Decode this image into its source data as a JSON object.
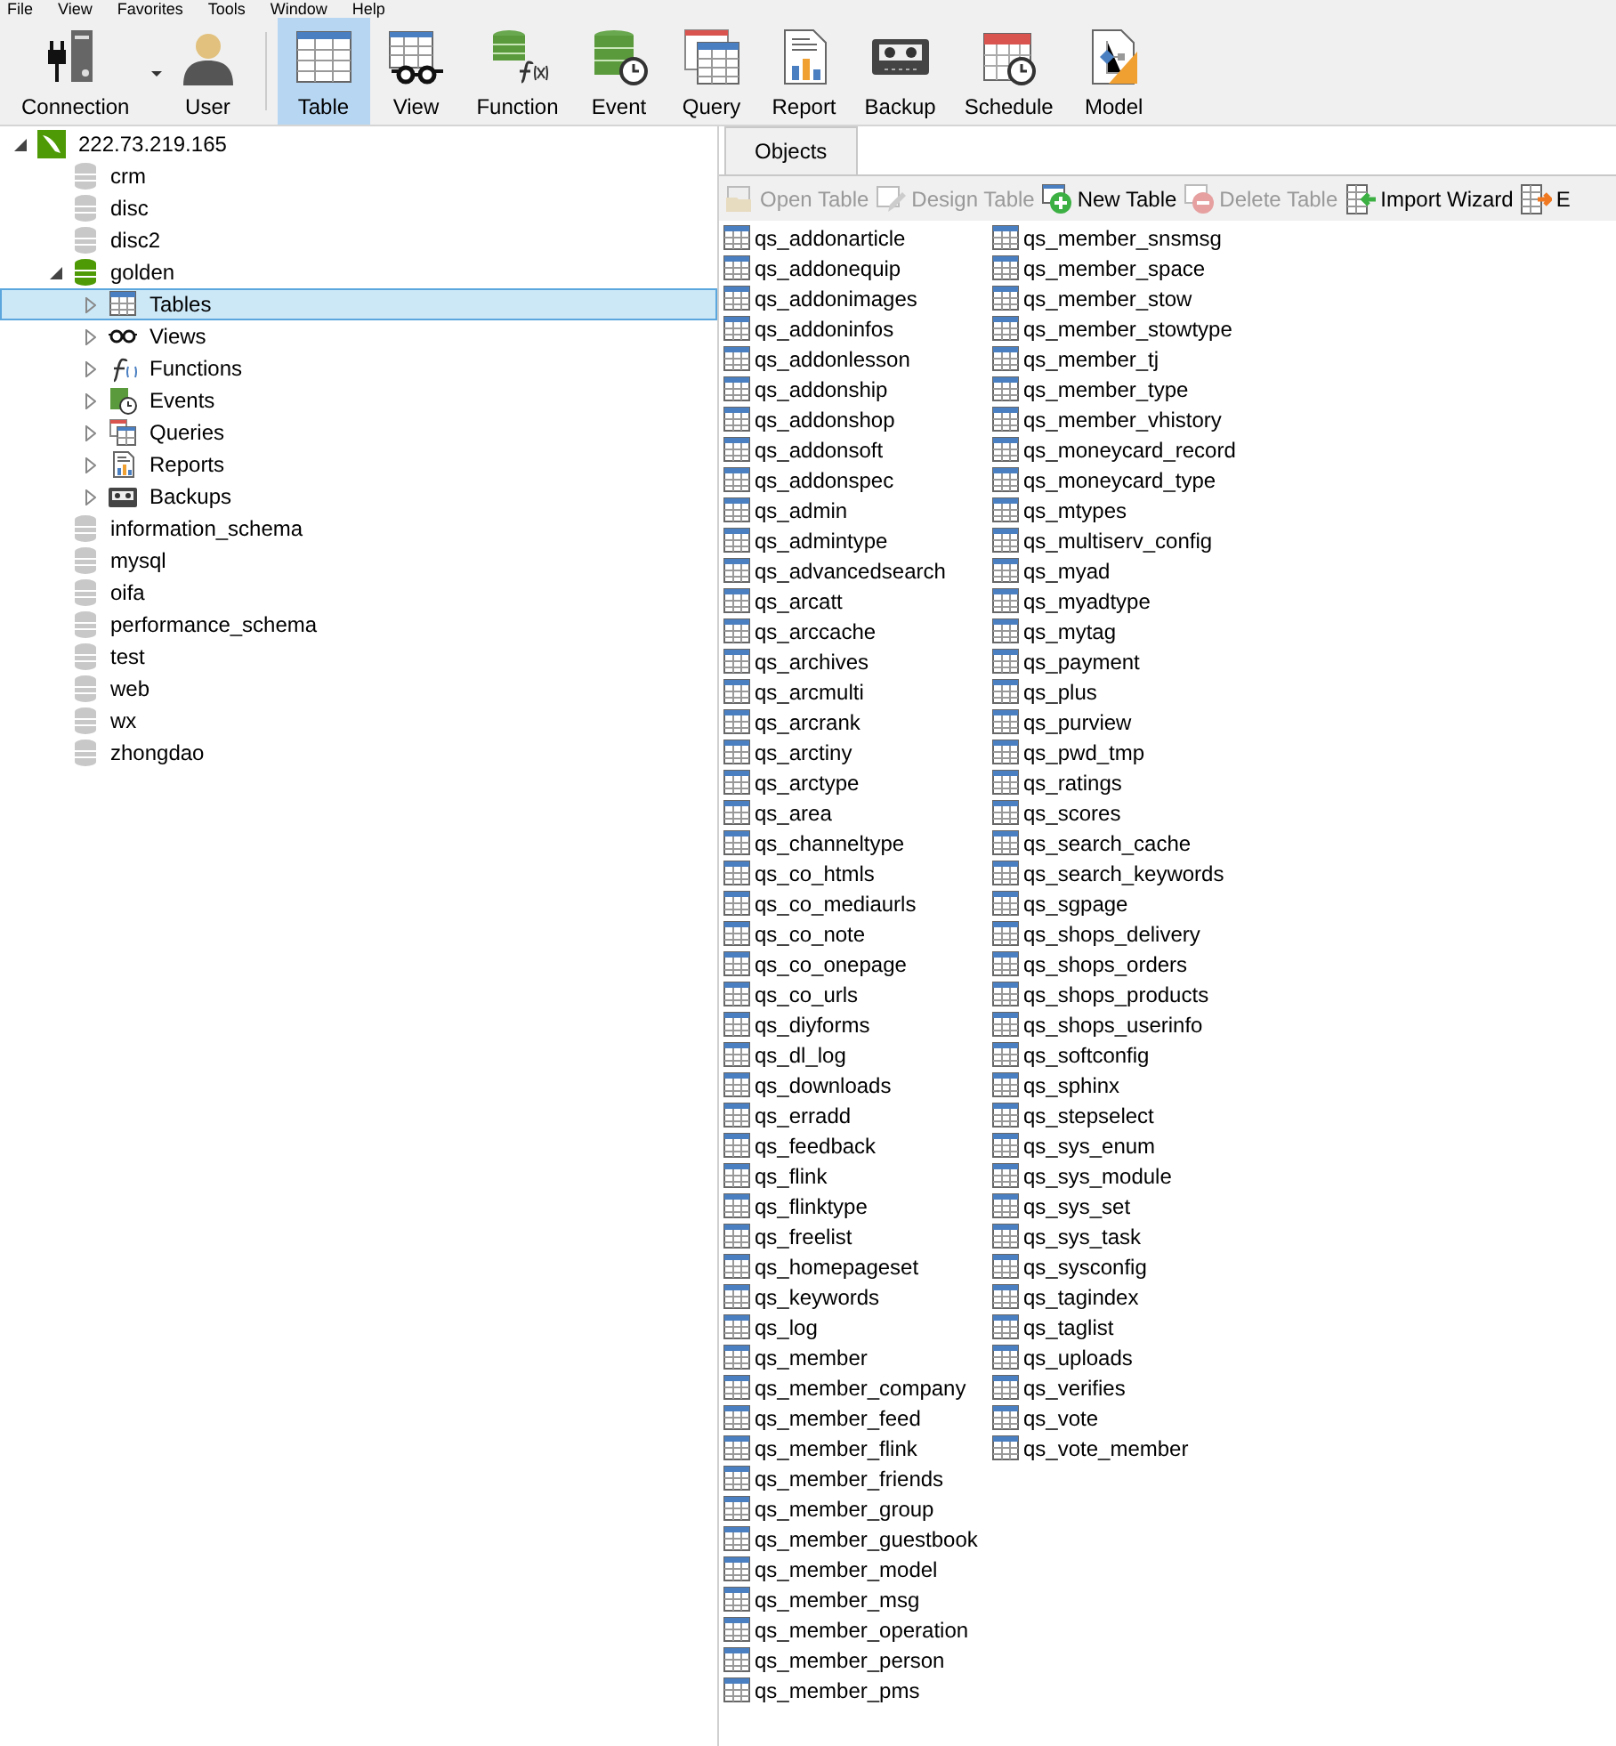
{
  "menu": [
    "File",
    "View",
    "Favorites",
    "Tools",
    "Window",
    "Help"
  ],
  "toolbar": [
    {
      "kind": "connection",
      "label": "Connection",
      "selected": false,
      "dropdown": true
    },
    {
      "kind": "user",
      "label": "User",
      "selected": false
    },
    {
      "kind": "table",
      "label": "Table",
      "selected": true
    },
    {
      "kind": "view",
      "label": "View",
      "selected": false
    },
    {
      "kind": "function",
      "label": "Function",
      "selected": false
    },
    {
      "kind": "event",
      "label": "Event",
      "selected": false
    },
    {
      "kind": "query",
      "label": "Query",
      "selected": false
    },
    {
      "kind": "report",
      "label": "Report",
      "selected": false
    },
    {
      "kind": "backup",
      "label": "Backup",
      "selected": false
    },
    {
      "kind": "schedule",
      "label": "Schedule",
      "selected": false
    },
    {
      "kind": "model",
      "label": "Model",
      "selected": false
    }
  ],
  "tree": [
    {
      "kind": "connection",
      "label": "222.73.219.165",
      "expanded": true,
      "selected": false,
      "children": [
        {
          "kind": "db",
          "label": "crm",
          "open": false,
          "selected": false
        },
        {
          "kind": "db",
          "label": "disc",
          "open": false,
          "selected": false
        },
        {
          "kind": "db",
          "label": "disc2",
          "open": false,
          "selected": false
        },
        {
          "kind": "db",
          "label": "golden",
          "open": true,
          "expanded": true,
          "selected": false,
          "children": [
            {
              "kind": "tables",
              "label": "Tables",
              "expanded": false,
              "selected": true
            },
            {
              "kind": "views",
              "label": "Views",
              "expanded": false,
              "selected": false
            },
            {
              "kind": "functions",
              "label": "Functions",
              "expanded": false,
              "selected": false
            },
            {
              "kind": "events",
              "label": "Events",
              "expanded": false,
              "selected": false
            },
            {
              "kind": "queries",
              "label": "Queries",
              "expanded": false,
              "selected": false
            },
            {
              "kind": "reports",
              "label": "Reports",
              "expanded": false,
              "selected": false
            },
            {
              "kind": "backups",
              "label": "Backups",
              "expanded": false,
              "selected": false
            }
          ]
        },
        {
          "kind": "db",
          "label": "information_schema",
          "open": false,
          "selected": false
        },
        {
          "kind": "db",
          "label": "mysql",
          "open": false,
          "selected": false
        },
        {
          "kind": "db",
          "label": "oifa",
          "open": false,
          "selected": false
        },
        {
          "kind": "db",
          "label": "performance_schema",
          "open": false,
          "selected": false
        },
        {
          "kind": "db",
          "label": "test",
          "open": false,
          "selected": false
        },
        {
          "kind": "db",
          "label": "web",
          "open": false,
          "selected": false
        },
        {
          "kind": "db",
          "label": "wx",
          "open": false,
          "selected": false
        },
        {
          "kind": "db",
          "label": "zhongdao",
          "open": false,
          "selected": false
        }
      ]
    }
  ],
  "tabs": [
    {
      "label": "Objects",
      "selected": true
    }
  ],
  "object_toolbar": [
    {
      "kind": "open",
      "label": "Open Table",
      "disabled": true
    },
    {
      "kind": "design",
      "label": "Design Table",
      "disabled": true
    },
    {
      "kind": "new",
      "label": "New Table",
      "disabled": false
    },
    {
      "kind": "delete",
      "label": "Delete Table",
      "disabled": true
    },
    {
      "kind": "import",
      "label": "Import Wizard",
      "disabled": false
    },
    {
      "kind": "export",
      "label": "E",
      "disabled": false
    }
  ],
  "tables": [
    "qs_addonarticle",
    "qs_addonequip",
    "qs_addonimages",
    "qs_addoninfos",
    "qs_addonlesson",
    "qs_addonship",
    "qs_addonshop",
    "qs_addonsoft",
    "qs_addonspec",
    "qs_admin",
    "qs_admintype",
    "qs_advancedsearch",
    "qs_arcatt",
    "qs_arccache",
    "qs_archives",
    "qs_arcmulti",
    "qs_arcrank",
    "qs_arctiny",
    "qs_arctype",
    "qs_area",
    "qs_channeltype",
    "qs_co_htmls",
    "qs_co_mediaurls",
    "qs_co_note",
    "qs_co_onepage",
    "qs_co_urls",
    "qs_diyforms",
    "qs_dl_log",
    "qs_downloads",
    "qs_erradd",
    "qs_feedback",
    "qs_flink",
    "qs_flinktype",
    "qs_freelist",
    "qs_homepageset",
    "qs_keywords",
    "qs_log",
    "qs_member",
    "qs_member_company",
    "qs_member_feed",
    "qs_member_flink",
    "qs_member_friends",
    "qs_member_group",
    "qs_member_guestbook",
    "qs_member_model",
    "qs_member_msg",
    "qs_member_operation",
    "qs_member_person",
    "qs_member_pms",
    "qs_member_snsmsg",
    "qs_member_space",
    "qs_member_stow",
    "qs_member_stowtype",
    "qs_member_tj",
    "qs_member_type",
    "qs_member_vhistory",
    "qs_moneycard_record",
    "qs_moneycard_type",
    "qs_mtypes",
    "qs_multiserv_config",
    "qs_myad",
    "qs_myadtype",
    "qs_mytag",
    "qs_payment",
    "qs_plus",
    "qs_purview",
    "qs_pwd_tmp",
    "qs_ratings",
    "qs_scores",
    "qs_search_cache",
    "qs_search_keywords",
    "qs_sgpage",
    "qs_shops_delivery",
    "qs_shops_orders",
    "qs_shops_products",
    "qs_shops_userinfo",
    "qs_softconfig",
    "qs_sphinx",
    "qs_stepselect",
    "qs_sys_enum",
    "qs_sys_module",
    "qs_sys_set",
    "qs_sys_task",
    "qs_sysconfig",
    "qs_tagindex",
    "qs_taglist",
    "qs_uploads",
    "qs_verifies",
    "qs_vote",
    "qs_vote_member"
  ]
}
